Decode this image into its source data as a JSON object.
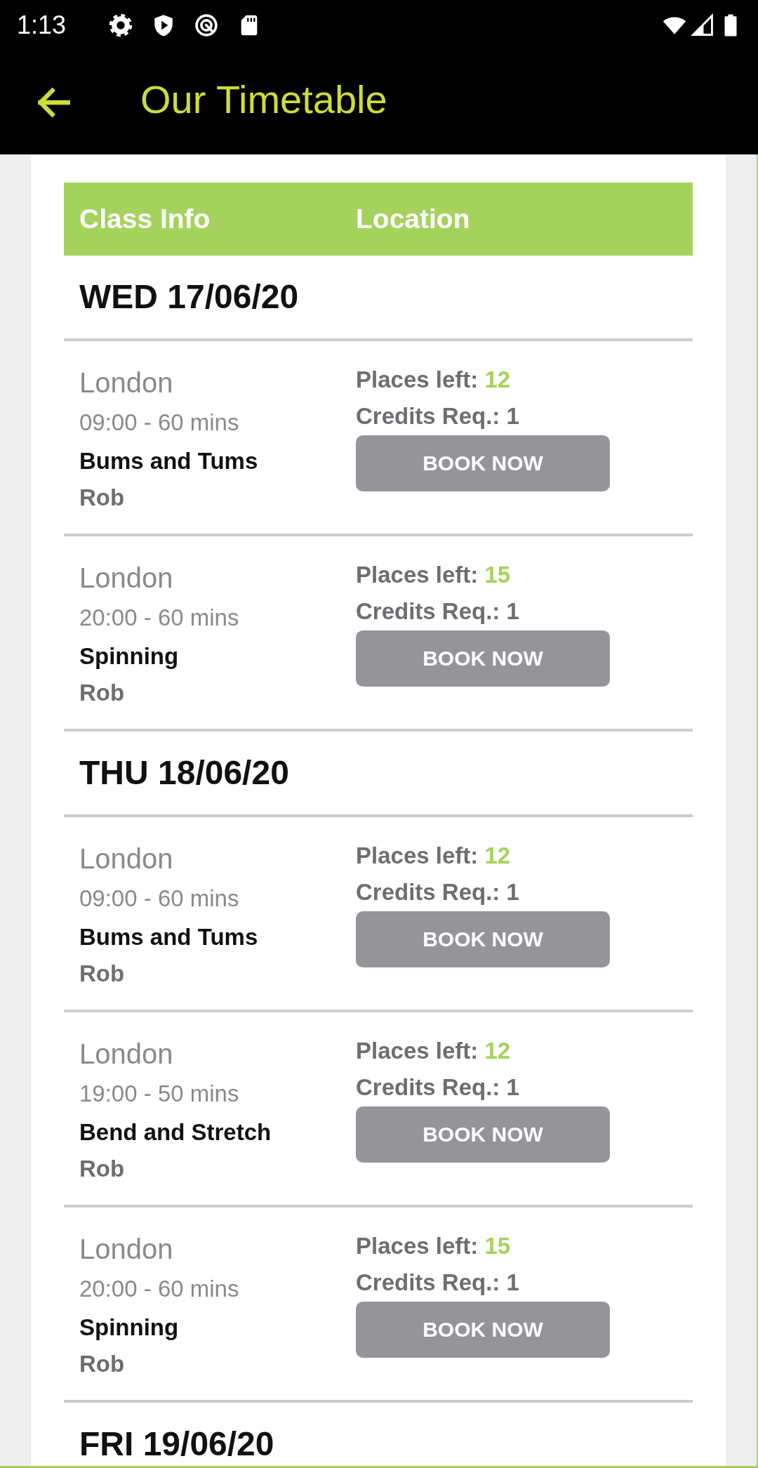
{
  "status_bar": {
    "time": "1:13"
  },
  "app_bar": {
    "title": "Our Timetable"
  },
  "timetable": {
    "columns": [
      "Class Info",
      "Location"
    ],
    "days": [
      {
        "date": "WED 17/06/20",
        "classes": [
          {
            "location": "London",
            "time": "09:00 - 60 mins",
            "name": "Bums and Tums",
            "instructor": "Rob",
            "places_label": "Places left:",
            "places": "12",
            "credits": "Credits Req.: 1",
            "button": "BOOK NOW"
          },
          {
            "location": "London",
            "time": "20:00 - 60 mins",
            "name": "Spinning",
            "instructor": "Rob",
            "places_label": "Places left:",
            "places": "15",
            "credits": "Credits Req.: 1",
            "button": "BOOK NOW"
          }
        ]
      },
      {
        "date": "THU 18/06/20",
        "classes": [
          {
            "location": "London",
            "time": "09:00 - 60 mins",
            "name": "Bums and Tums",
            "instructor": "Rob",
            "places_label": "Places left:",
            "places": "12",
            "credits": "Credits Req.: 1",
            "button": "BOOK NOW"
          },
          {
            "location": "London",
            "time": "19:00 - 50 mins",
            "name": "Bend and Stretch",
            "instructor": "Rob",
            "places_label": "Places left:",
            "places": "12",
            "credits": "Credits Req.: 1",
            "button": "BOOK NOW"
          },
          {
            "location": "London",
            "time": "20:00 - 60 mins",
            "name": "Spinning",
            "instructor": "Rob",
            "places_label": "Places left:",
            "places": "15",
            "credits": "Credits Req.: 1",
            "button": "BOOK NOW"
          }
        ]
      },
      {
        "date": "FRI 19/06/20"
      }
    ]
  }
}
